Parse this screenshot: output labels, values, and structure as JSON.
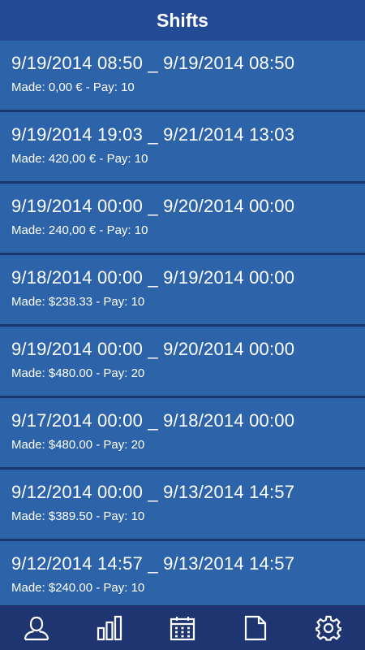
{
  "header": {
    "title": "Shifts"
  },
  "shifts": [
    {
      "range": "9/19/2014 08:50 _ 9/19/2014 08:50",
      "meta": "Made: 0,00 € - Pay: 10"
    },
    {
      "range": "9/19/2014 19:03 _ 9/21/2014 13:03",
      "meta": "Made: 420,00 € - Pay: 10"
    },
    {
      "range": "9/19/2014 00:00 _ 9/20/2014 00:00",
      "meta": "Made: 240,00 € - Pay: 10"
    },
    {
      "range": "9/18/2014 00:00 _ 9/19/2014 00:00",
      "meta": "Made: $238.33 - Pay: 10"
    },
    {
      "range": "9/19/2014 00:00 _ 9/20/2014 00:00",
      "meta": "Made: $480.00 - Pay: 20"
    },
    {
      "range": "9/17/2014 00:00 _ 9/18/2014 00:00",
      "meta": "Made: $480.00 - Pay: 20"
    },
    {
      "range": "9/12/2014 00:00 _ 9/13/2014 14:57",
      "meta": "Made: $389.50 - Pay: 10"
    },
    {
      "range": "9/12/2014 14:57 _ 9/13/2014 14:57",
      "meta": "Made: $240.00 - Pay: 10"
    }
  ],
  "tabs": [
    {
      "icon": "user-icon"
    },
    {
      "icon": "bar-chart-icon"
    },
    {
      "icon": "calendar-icon"
    },
    {
      "icon": "document-icon"
    },
    {
      "icon": "gear-icon"
    }
  ],
  "colors": {
    "header": "#234a94",
    "item": "#2d63a9",
    "tabbar": "#1e3572",
    "text": "#ffffff"
  }
}
